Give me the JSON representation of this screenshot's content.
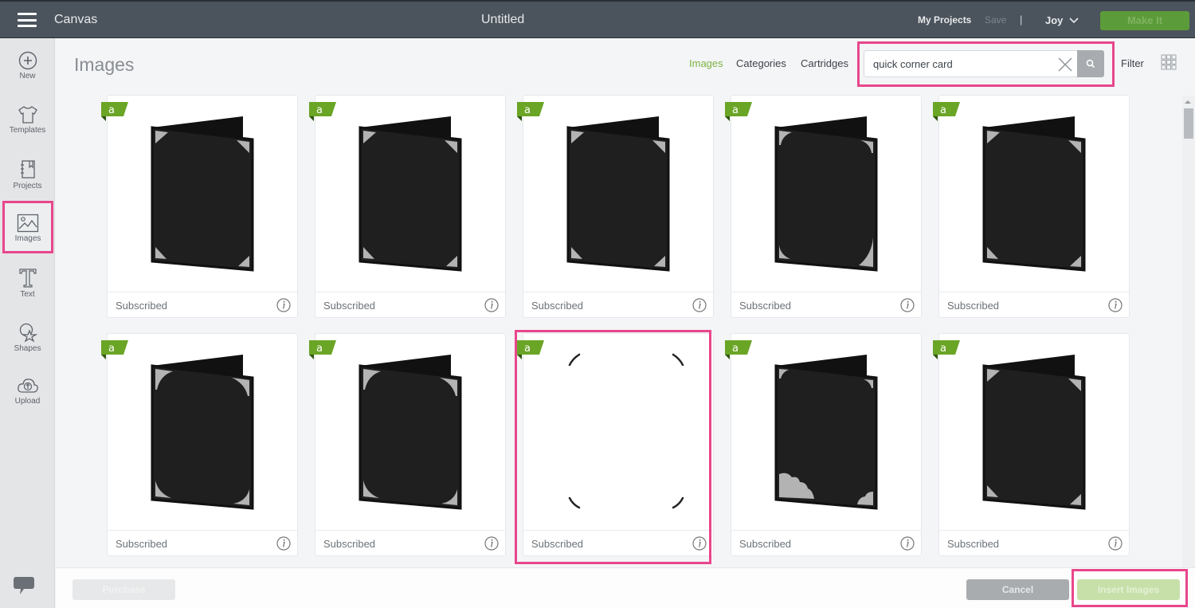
{
  "topbar": {
    "app_title": "Canvas",
    "doc_title": "Untitled",
    "my_projects": "My Projects",
    "save": "Save",
    "separator": "|",
    "user": "Joy",
    "make_it": "Make It"
  },
  "sidebar": {
    "items": [
      {
        "label": "New",
        "icon": "plus-circle-icon"
      },
      {
        "label": "Templates",
        "icon": "tshirt-icon"
      },
      {
        "label": "Projects",
        "icon": "notebook-icon"
      },
      {
        "label": "Images",
        "icon": "image-icon",
        "active": true
      },
      {
        "label": "Text",
        "icon": "text-t-icon"
      },
      {
        "label": "Shapes",
        "icon": "shapes-icon"
      },
      {
        "label": "Upload",
        "icon": "cloud-upload-icon"
      }
    ],
    "chat_icon": "chat-bubble-icon"
  },
  "header": {
    "title": "Images",
    "nav": [
      {
        "label": "Images",
        "active": true
      },
      {
        "label": "Categories",
        "active": false
      },
      {
        "label": "Cartridges",
        "active": false
      }
    ],
    "search": {
      "value": "quick corner card",
      "placeholder": "Search"
    },
    "filter": "Filter",
    "colors": {
      "accent": "#7cb342",
      "highlight": "#e8468c"
    }
  },
  "cards": [
    {
      "status": "Subscribed",
      "badge": "a",
      "style": "corner-triangles"
    },
    {
      "status": "Subscribed",
      "badge": "a",
      "style": "corner-triangles"
    },
    {
      "status": "Subscribed",
      "badge": "a",
      "style": "corner-triangles"
    },
    {
      "status": "Subscribed",
      "badge": "a",
      "style": "corner-curves"
    },
    {
      "status": "Subscribed",
      "badge": "a",
      "style": "corner-triangles"
    },
    {
      "status": "Subscribed",
      "badge": "a",
      "style": "corner-lace"
    },
    {
      "status": "Subscribed",
      "badge": "a",
      "style": "corner-lace"
    },
    {
      "status": "Subscribed",
      "badge": "a",
      "style": "corner-arcs",
      "highlighted": true
    },
    {
      "status": "Subscribed",
      "badge": "a",
      "style": "corner-clouds"
    },
    {
      "status": "Subscribed",
      "badge": "a",
      "style": "corner-triangles"
    }
  ],
  "footer": {
    "left_button": "Purchase",
    "cancel": "Cancel",
    "insert": "Insert Images"
  }
}
